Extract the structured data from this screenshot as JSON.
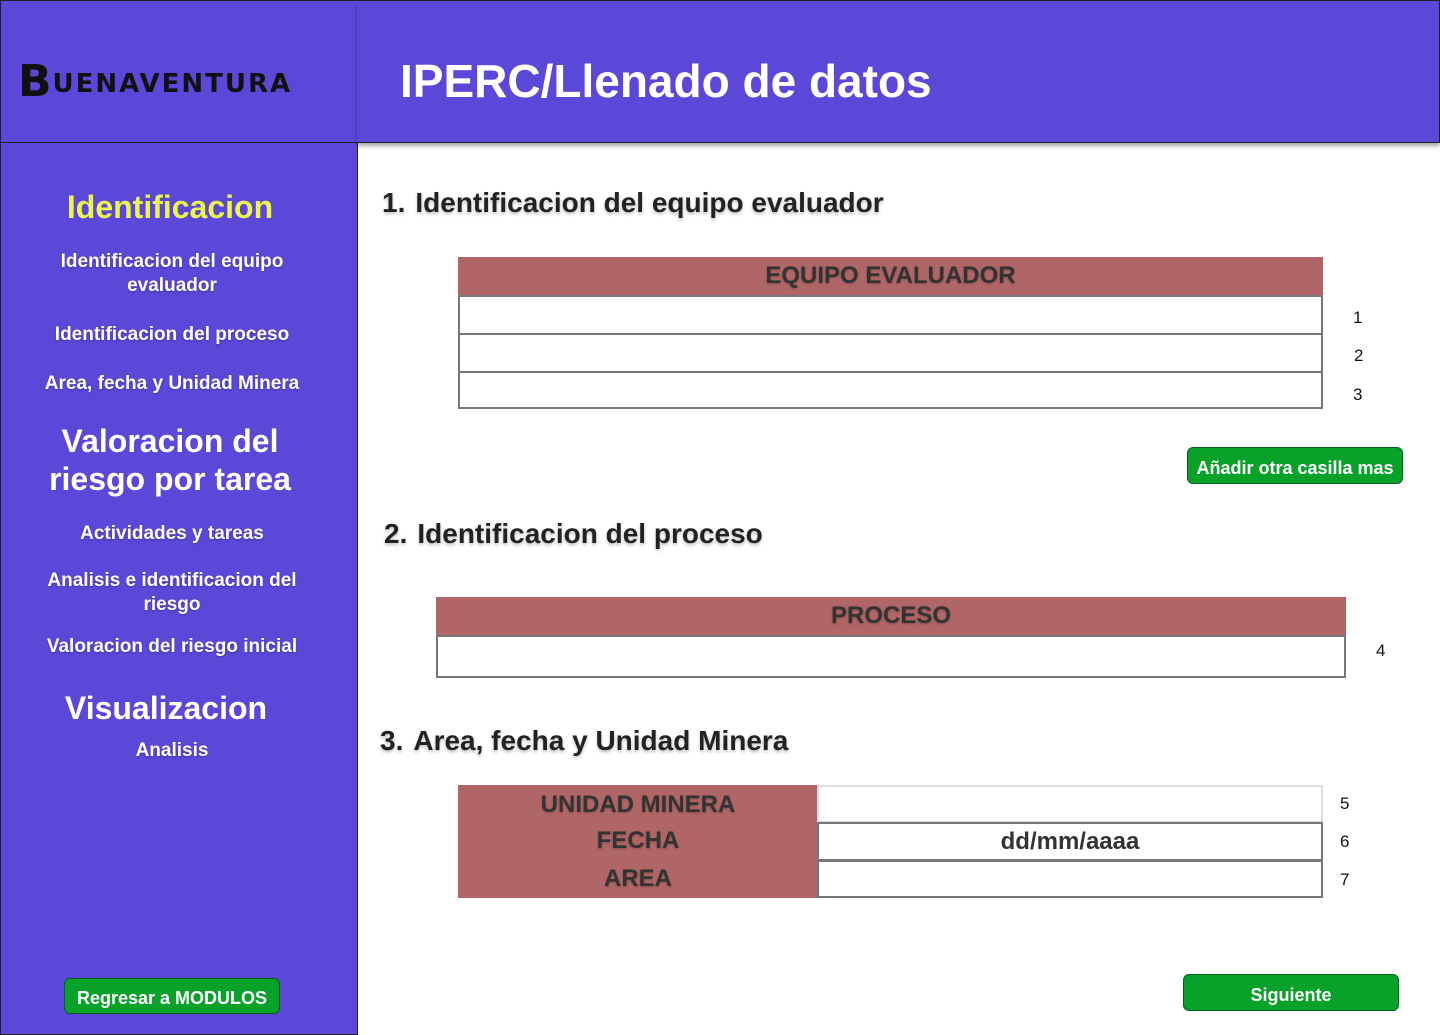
{
  "app": {
    "logo_initial": "B",
    "logo_rest": "UENAVENTURA",
    "title": "IPERC/Llenado de datos"
  },
  "sidebar": {
    "sections": [
      {
        "heading": "Identificacion",
        "items": [
          "Identificacion del equipo evaluador",
          "Identificacion del proceso",
          "Area, fecha y Unidad Minera"
        ]
      },
      {
        "heading": "Valoracion del riesgo por tarea",
        "items": [
          "Actividades y tareas",
          "Analisis e identificacion del riesgo",
          "Valoracion del riesgo inicial"
        ]
      },
      {
        "heading": "Visualizacion",
        "items": [
          "Analisis"
        ]
      }
    ],
    "back_button": "Regresar a MODULOS"
  },
  "section1": {
    "number": "1.",
    "title": "Identificacion del equipo evaluador",
    "table_header": "EQUIPO EVALUADOR",
    "rows": [
      {
        "value": "",
        "index": "1"
      },
      {
        "value": "",
        "index": "2"
      },
      {
        "value": "",
        "index": "3"
      }
    ],
    "add_button": "Añadir otra casilla mas"
  },
  "section2": {
    "number": "2.",
    "title": "Identificacion del proceso",
    "table_header": "PROCESO",
    "row": {
      "value": "",
      "index": "4"
    }
  },
  "section3": {
    "number": "3.",
    "title": "Area, fecha y Unidad Minera",
    "fields": [
      {
        "label": "UNIDAD MINERA",
        "value": "",
        "index": "5"
      },
      {
        "label": "FECHA",
        "value": "dd/mm/aaaa",
        "index": "6"
      },
      {
        "label": "AREA",
        "value": "",
        "index": "7"
      }
    ]
  },
  "next_button": "Siguiente",
  "colors": {
    "primary": "#5b48d8",
    "header_cell": "#b06666",
    "button": "#08a12a",
    "active_nav": "#ecf54a"
  }
}
